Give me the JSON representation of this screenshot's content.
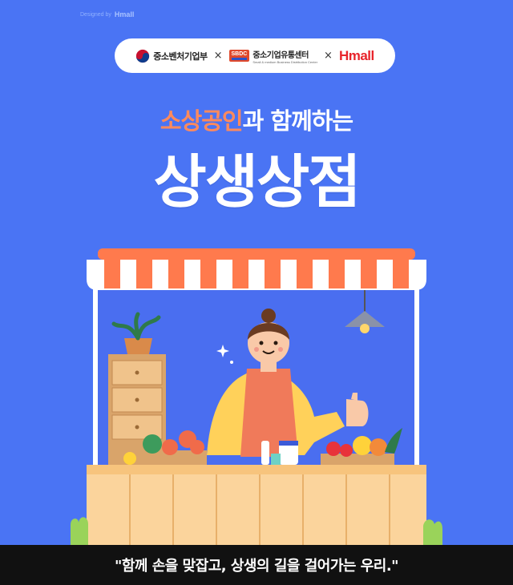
{
  "header": {
    "designed_by": "Designed by",
    "designed_by_brand": "Hmall"
  },
  "logos": {
    "ministry": "중소벤처기업부",
    "separator": "×",
    "sbdc_mark": "SBDC",
    "sbdc_name": "중소기업유통센터",
    "sbdc_sub": "Small & medium Business Distribution Center",
    "hmall": "Hmall"
  },
  "headline": {
    "accent": "소상공인",
    "rest": "과 함께하는",
    "title": "상생상점"
  },
  "caption": "\"함께 손을 맞잡고, 상생의 길을 걸어가는 우리.\"",
  "colors": {
    "background": "#4a74f4",
    "accent": "#ff8a5c",
    "awning_orange": "#ff7a4d",
    "counter": "#fbd49c",
    "caption_bg": "#111111"
  }
}
